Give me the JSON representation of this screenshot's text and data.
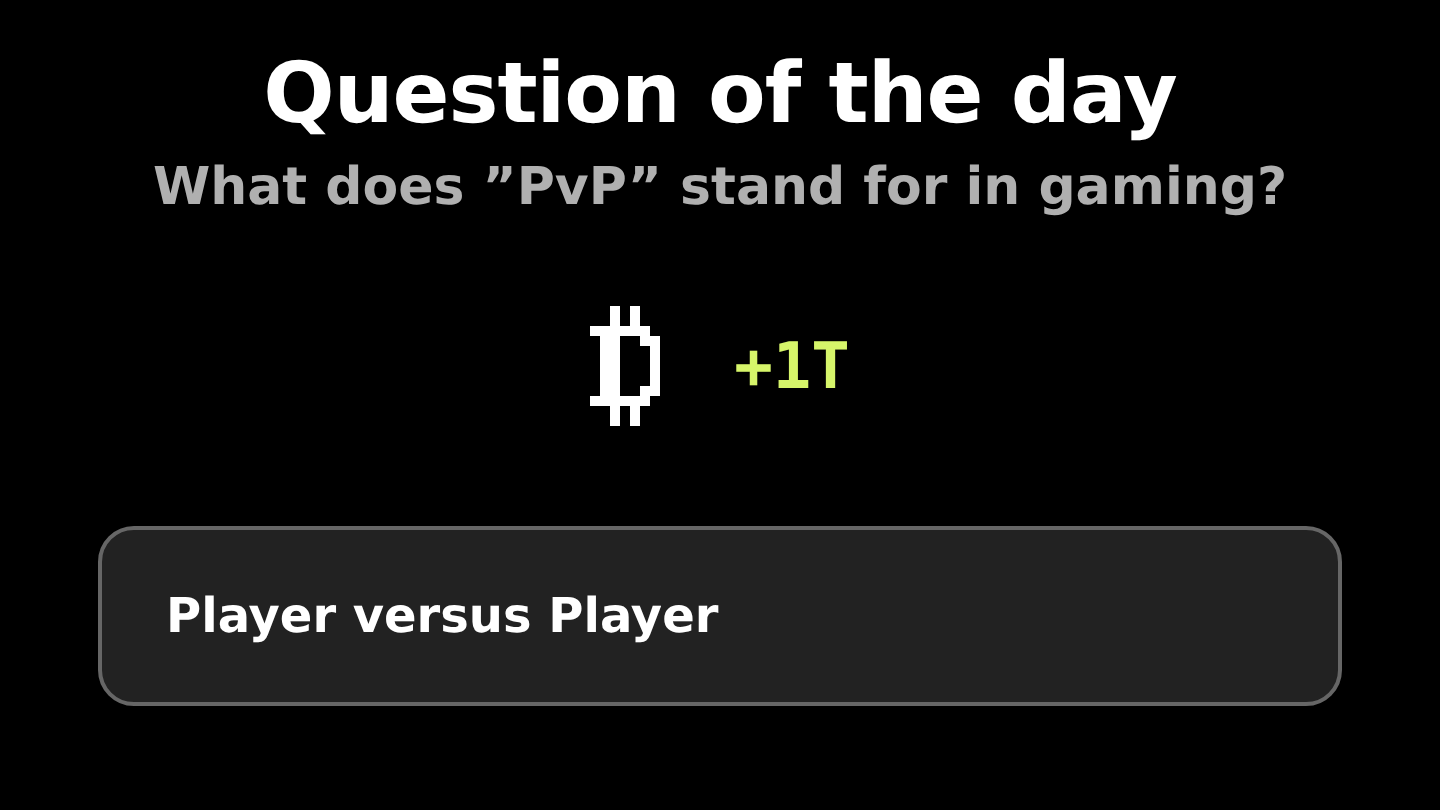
{
  "title": "Question of the day",
  "question": "What does ”PvP” stand for in gaming?",
  "reward": "+1T",
  "answers": [
    {
      "label": "Player versus Player"
    }
  ]
}
